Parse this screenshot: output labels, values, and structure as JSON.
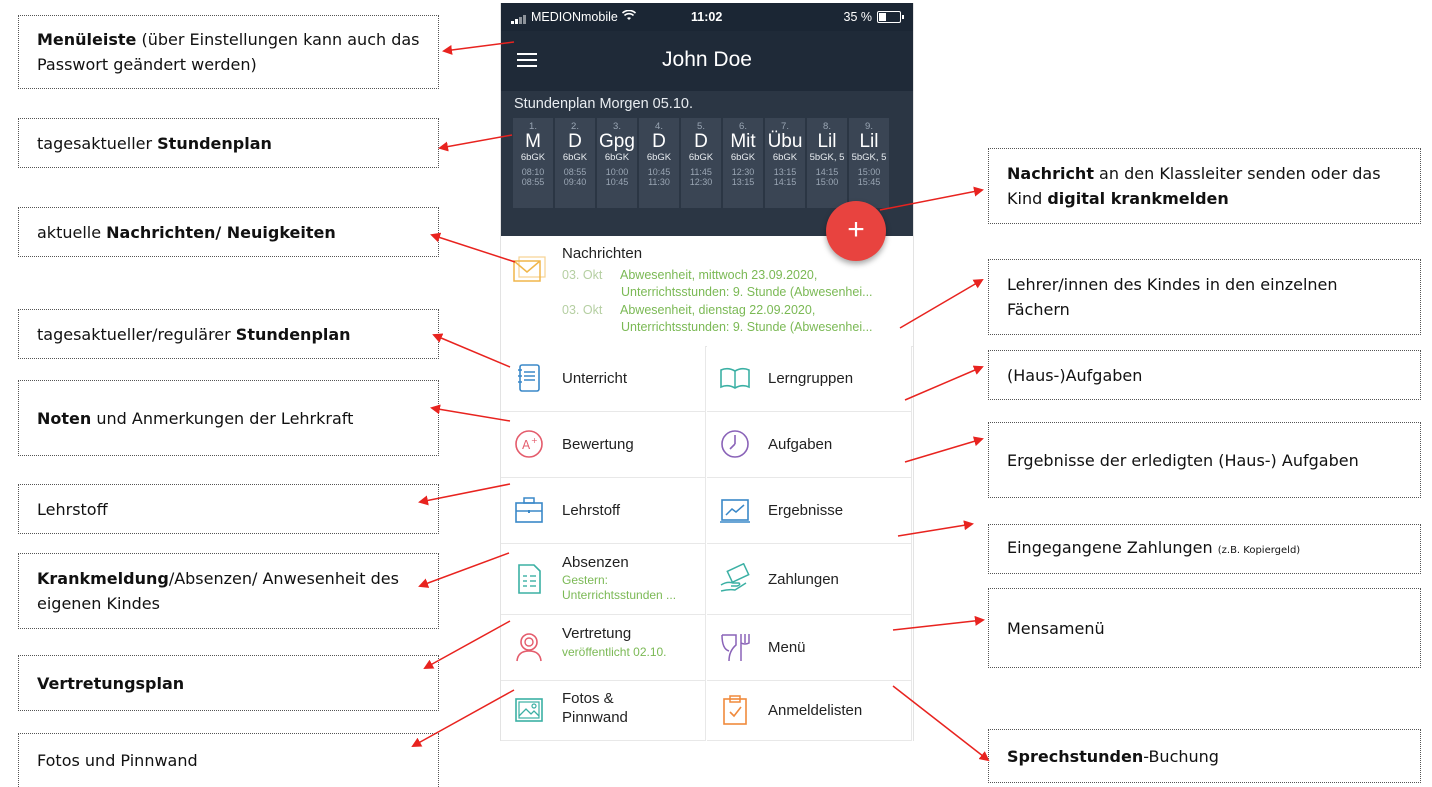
{
  "phone": {
    "statusbar": {
      "carrier": "MEDIONmobile",
      "time": "11:02",
      "battery": "35 %"
    },
    "title": "John Doe",
    "schedule": {
      "heading": "Stundenplan Morgen 05.10.",
      "slots": [
        {
          "n": "1.",
          "s": "M",
          "c": "6bGK",
          "t1": "08:10",
          "t2": "08:55"
        },
        {
          "n": "2.",
          "s": "D",
          "c": "6bGK",
          "t1": "08:55",
          "t2": "09:40"
        },
        {
          "n": "3.",
          "s": "Gpg",
          "c": "6bGK",
          "t1": "10:00",
          "t2": "10:45"
        },
        {
          "n": "4.",
          "s": "D",
          "c": "6bGK",
          "t1": "10:45",
          "t2": "11:30"
        },
        {
          "n": "5.",
          "s": "D",
          "c": "6bGK",
          "t1": "11:45",
          "t2": "12:30"
        },
        {
          "n": "6.",
          "s": "Mit",
          "c": "6bGK",
          "t1": "12:30",
          "t2": "13:15"
        },
        {
          "n": "7.",
          "s": "Übu",
          "c": "6bGK",
          "t1": "13:15",
          "t2": "14:15"
        },
        {
          "n": "8.",
          "s": "Lil",
          "c": "5bGK, 5",
          "t1": "14:15",
          "t2": "15:00"
        },
        {
          "n": "9.",
          "s": "Lil",
          "c": "5bGK, 5",
          "t1": "15:00",
          "t2": "15:45"
        }
      ]
    },
    "fab_label": "+",
    "news": {
      "title": "Nachrichten",
      "items": [
        {
          "date": "03. Okt",
          "line1": "Abwesenheit, mittwoch 23.09.2020,",
          "line2": "Unterrichtsstunden: 9. Stunde (Abwesenhei..."
        },
        {
          "date": "03. Okt",
          "line1": "Abwesenheit, dienstag 22.09.2020,",
          "line2": "Unterrichtsstunden: 9. Stunde (Abwesenhei..."
        }
      ]
    },
    "menu": {
      "unterricht": "Unterricht",
      "lerngruppen": "Lerngruppen",
      "bewertung": "Bewertung",
      "aufgaben": "Aufgaben",
      "lehrstoff": "Lehrstoff",
      "ergebnisse": "Ergebnisse",
      "absenzen": "Absenzen",
      "absenzen_sub1": "Gestern:",
      "absenzen_sub2": "Unterrichtsstunden ...",
      "zahlungen": "Zahlungen",
      "vertretung": "Vertretung",
      "vertretung_sub": "veröffentlicht 02.10.",
      "menue": "Menü",
      "fotos1": "Fotos &",
      "fotos2": "Pinnwand",
      "anmeldelisten": "Anmeldelisten"
    }
  },
  "annotations": {
    "menueleiste": {
      "bold": "Menüleiste",
      "rest": " (über Einstellungen kann auch das Passwort geändert werden)"
    },
    "stundenplan_tag": {
      "pre": "tagesaktueller ",
      "bold": "Stundenplan"
    },
    "nachrichten": {
      "pre": "aktuelle ",
      "bold": "Nachrichten/ Neuigkeiten"
    },
    "stundenplan_reg": {
      "pre": "tagesaktueller/regulärer ",
      "bold": "Stundenplan"
    },
    "noten": {
      "bold": "Noten",
      "rest": " und Anmerkungen der Lehrkraft"
    },
    "lehrstoff": {
      "text": "Lehrstoff"
    },
    "krankmeldung": {
      "bold": "Krankmeldung",
      "rest": "/Absenzen/ Anwesenheit des eigenen Kindes"
    },
    "vertretungsplan": {
      "bold": "Vertretungsplan"
    },
    "fotos": {
      "text": "Fotos und Pinnwand"
    },
    "nachricht_right": {
      "b1": "Nachricht",
      "t1": " an den Klassleiter senden oder das Kind ",
      "b2": "digital krankmelden"
    },
    "lehrer": {
      "text": "Lehrer/innen des Kindes in den einzelnen Fächern"
    },
    "aufgaben": {
      "text": "(Haus-)Aufgaben"
    },
    "ergebnisse": {
      "text": "Ergebnisse der erledigten (Haus-) Aufgaben"
    },
    "zahlungen": {
      "text": "Eingegangene Zahlungen ",
      "small": "(z.B. Kopiergeld)"
    },
    "mensa": {
      "text": "Mensamenü"
    },
    "sprechstunden": {
      "bold": "Sprechstunden",
      "rest": "-Buchung"
    }
  },
  "colors": {
    "accent_red": "#e8433f",
    "green_text": "#7bb955",
    "dark_header": "#1f2a38"
  }
}
